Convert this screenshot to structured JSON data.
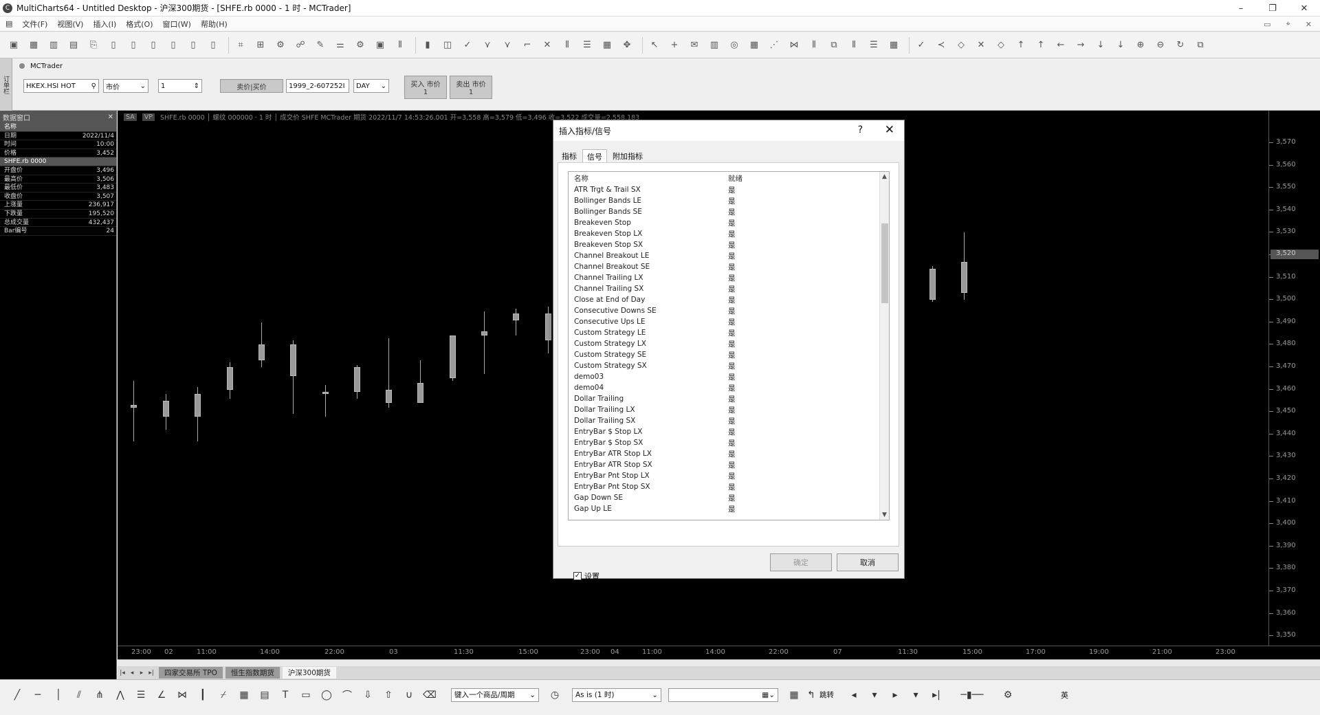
{
  "window": {
    "title": "MultiCharts64 - Untitled Desktop - 沪深300期货 - [SHFE.rb 0000 - 1 时 - MCTrader]",
    "app_icon": "C"
  },
  "menu": [
    "文件(F)",
    "视图(V)",
    "插入(I)",
    "格式(O)",
    "窗口(W)",
    "帮助(H)"
  ],
  "trading_panel": {
    "tab_label": "MCTrader",
    "symbol": "HKEX.HSI HOT",
    "order_type": "市价",
    "quantity": "1",
    "buy_sell_label": "卖价|买价",
    "account": "1999_2-607252I",
    "tif": "DAY",
    "buy_button": {
      "label": "买入 市价",
      "qty": "1"
    },
    "sell_button": {
      "label": "卖出 市价",
      "qty": "1"
    }
  },
  "data_window": {
    "title": "数据窗口",
    "rows": [
      {
        "label": "名称",
        "value": "",
        "group": true
      },
      {
        "label": "日期",
        "value": "2022/11/4"
      },
      {
        "label": "时间",
        "value": "10:00"
      },
      {
        "label": "价格",
        "value": "3,452"
      },
      {
        "label": "SHFE.rb 0000",
        "value": "",
        "group": true
      },
      {
        "label": "开盘价",
        "value": "3,496"
      },
      {
        "label": "最高价",
        "value": "3,506"
      },
      {
        "label": "最低价",
        "value": "3,483"
      },
      {
        "label": "收盘价",
        "value": "3,507"
      },
      {
        "label": "上涨量",
        "value": "236,917"
      },
      {
        "label": "下跌量",
        "value": "195,520"
      },
      {
        "label": "总成交量",
        "value": "432,437"
      },
      {
        "label": "Bar编号",
        "value": "24"
      }
    ]
  },
  "chart": {
    "status_line": "SHFE.rb 0000 │ 螺纹 000000 · 1 时 │ 成交价 SHFE MCTrader 期货 2022/11/7 14:53:26.001 开=3,558 高=3,579 低=3,496 收=3,522 成交量=2,558,183",
    "status_boxes": [
      "SA",
      "VP"
    ],
    "price_ticks": [
      "3,570",
      "3,560",
      "3,550",
      "3,540",
      "3,530",
      "3,520",
      "3,510",
      "3,500",
      "3,490",
      "3,480",
      "3,470",
      "3,460",
      "3,450",
      "3,440",
      "3,430",
      "3,420",
      "3,410",
      "3,400",
      "3,390",
      "3,380",
      "3,370",
      "3,360",
      "3,350"
    ],
    "price_marker": "3,520",
    "time_ticks": [
      "23:00",
      "02",
      "11:00",
      "14:00",
      "22:00",
      "03",
      "11:30",
      "15:00",
      "23:00",
      "04",
      "11:00",
      "14:00",
      "22:00",
      "07",
      "11:30",
      "15:00",
      "17:00",
      "19:00",
      "21:00",
      "23:00"
    ],
    "candles": [
      {
        "o": 3453,
        "h": 3464,
        "l": 3437,
        "c": 3452
      },
      {
        "o": 3448,
        "h": 3458,
        "l": 3442,
        "c": 3455
      },
      {
        "o": 3448,
        "h": 3461,
        "l": 3437,
        "c": 3458
      },
      {
        "o": 3460,
        "h": 3472,
        "l": 3456,
        "c": 3470
      },
      {
        "o": 3473,
        "h": 3490,
        "l": 3470,
        "c": 3480
      },
      {
        "o": 3480,
        "h": 3482,
        "l": 3449,
        "c": 3466
      },
      {
        "o": 3459,
        "h": 3462,
        "l": 3448,
        "c": 3458
      },
      {
        "o": 3459,
        "h": 3471,
        "l": 3456,
        "c": 3470
      },
      {
        "o": 3460,
        "h": 3483,
        "l": 3452,
        "c": 3454
      },
      {
        "o": 3463,
        "h": 3473,
        "l": 3454,
        "c": 3454
      },
      {
        "o": 3465,
        "h": 3483,
        "l": 3464,
        "c": 3484
      },
      {
        "o": 3484,
        "h": 3495,
        "l": 3467,
        "c": 3486
      },
      {
        "o": 3494,
        "h": 3496,
        "l": 3484,
        "c": 3491
      },
      {
        "o": 3494,
        "h": 3497,
        "l": 3476,
        "c": 3482
      },
      {
        "o": 3473,
        "h": 3477,
        "l": 3466,
        "c": 3470
      },
      {
        "o": 3500,
        "h": 3515,
        "l": 3499,
        "c": 3514
      },
      {
        "o": 3503,
        "h": 3530,
        "l": 3500,
        "c": 3517
      }
    ]
  },
  "sheet_tabs": [
    "四家交易所 TPO",
    "恒生指数期货",
    "沪深300期货"
  ],
  "bottom_toolbar": {
    "symbol_placeholder": "键入一个商品/周期",
    "resolution": "As is (1 时)",
    "jump_label": "跳转",
    "ime": "英"
  },
  "dialog": {
    "title": "插入指标/信号",
    "tabs": [
      "指标",
      "信号",
      "附加指标"
    ],
    "active_tab": 1,
    "columns": [
      "名称",
      "就绪"
    ],
    "items": [
      {
        "name": "ATR Trgt & Trail SX",
        "ready": "是"
      },
      {
        "name": "Bollinger Bands LE",
        "ready": "是"
      },
      {
        "name": "Bollinger Bands SE",
        "ready": "是"
      },
      {
        "name": "Breakeven Stop",
        "ready": "是"
      },
      {
        "name": "Breakeven Stop LX",
        "ready": "是"
      },
      {
        "name": "Breakeven Stop SX",
        "ready": "是"
      },
      {
        "name": "Channel Breakout LE",
        "ready": "是"
      },
      {
        "name": "Channel Breakout SE",
        "ready": "是"
      },
      {
        "name": "Channel Trailing LX",
        "ready": "是"
      },
      {
        "name": "Channel Trailing SX",
        "ready": "是"
      },
      {
        "name": "Close at End of Day",
        "ready": "是"
      },
      {
        "name": "Consecutive Downs SE",
        "ready": "是"
      },
      {
        "name": "Consecutive Ups LE",
        "ready": "是"
      },
      {
        "name": "Custom Strategy LE",
        "ready": "是"
      },
      {
        "name": "Custom Strategy LX",
        "ready": "是"
      },
      {
        "name": "Custom Strategy SE",
        "ready": "是"
      },
      {
        "name": "Custom Strategy SX",
        "ready": "是"
      },
      {
        "name": "demo03",
        "ready": "是"
      },
      {
        "name": "demo04",
        "ready": "是"
      },
      {
        "name": "Dollar Trailing",
        "ready": "是"
      },
      {
        "name": "Dollar Trailing LX",
        "ready": "是"
      },
      {
        "name": "Dollar Trailing SX",
        "ready": "是"
      },
      {
        "name": "EntryBar $ Stop LX",
        "ready": "是"
      },
      {
        "name": "EntryBar $ Stop SX",
        "ready": "是"
      },
      {
        "name": "EntryBar ATR Stop LX",
        "ready": "是"
      },
      {
        "name": "EntryBar ATR Stop SX",
        "ready": "是"
      },
      {
        "name": "EntryBar Pnt Stop LX",
        "ready": "是"
      },
      {
        "name": "EntryBar Pnt Stop SX",
        "ready": "是"
      },
      {
        "name": "Gap Down SE",
        "ready": "是"
      },
      {
        "name": "Gap Up LE",
        "ready": "是"
      }
    ],
    "settings_label": "设置",
    "settings_checked": true,
    "ok_label": "确定",
    "cancel_label": "取消"
  }
}
